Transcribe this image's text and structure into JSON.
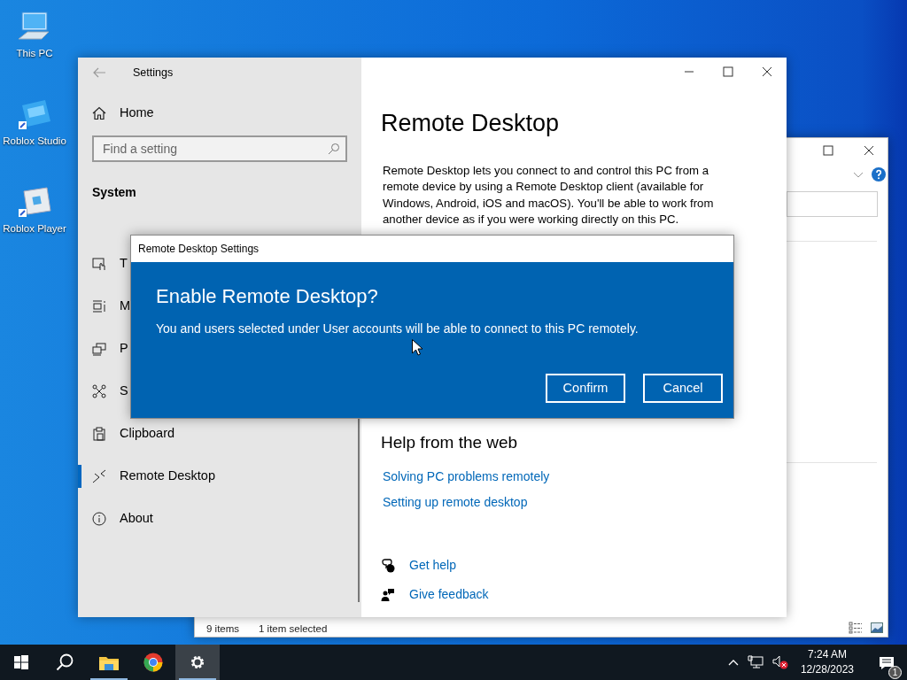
{
  "desktop_icons": [
    {
      "label": "This PC",
      "kind": "computer"
    },
    {
      "label": "Roblox Studio",
      "kind": "studio"
    },
    {
      "label": "Roblox Player",
      "kind": "player"
    }
  ],
  "explorer": {
    "status": [
      "9 items",
      "1 item selected"
    ]
  },
  "settings": {
    "title": "Settings",
    "home": "Home",
    "search": {
      "placeholder": "Find a setting"
    },
    "section": "System",
    "nav": [
      {
        "label": "T",
        "selected": false
      },
      {
        "label": "M",
        "selected": false
      },
      {
        "label": "P",
        "selected": false
      },
      {
        "label": "S",
        "selected": false
      },
      {
        "label": "Clipboard",
        "selected": false
      },
      {
        "label": "Remote Desktop",
        "selected": true
      },
      {
        "label": "About",
        "selected": false
      }
    ],
    "heading": "Remote Desktop",
    "description": "Remote Desktop lets you connect to and control this PC from a remote device by using a Remote Desktop client (available for Windows, Android, iOS and macOS). You'll be able to work from another device as if you were working directly on this PC.",
    "help_heading": "Help from the web",
    "links": [
      "Solving PC problems remotely",
      "Setting up remote desktop"
    ],
    "support": [
      "Get help",
      "Give feedback"
    ]
  },
  "dialog": {
    "title": "Remote Desktop Settings",
    "heading": "Enable Remote Desktop?",
    "message": "You and users selected under User accounts will be able to connect to this PC remotely.",
    "buttons": [
      "Confirm",
      "Cancel"
    ]
  },
  "taskbar": {
    "apps": [
      {
        "kind": "start",
        "running": false,
        "selected": false
      },
      {
        "kind": "search",
        "running": false,
        "selected": false
      },
      {
        "kind": "folder",
        "running": true,
        "selected": false
      },
      {
        "kind": "browser",
        "running": false,
        "selected": false
      },
      {
        "kind": "settings",
        "running": true,
        "selected": true
      }
    ],
    "time": "7:24 AM",
    "date": "12/28/2023",
    "notifications": "1"
  }
}
